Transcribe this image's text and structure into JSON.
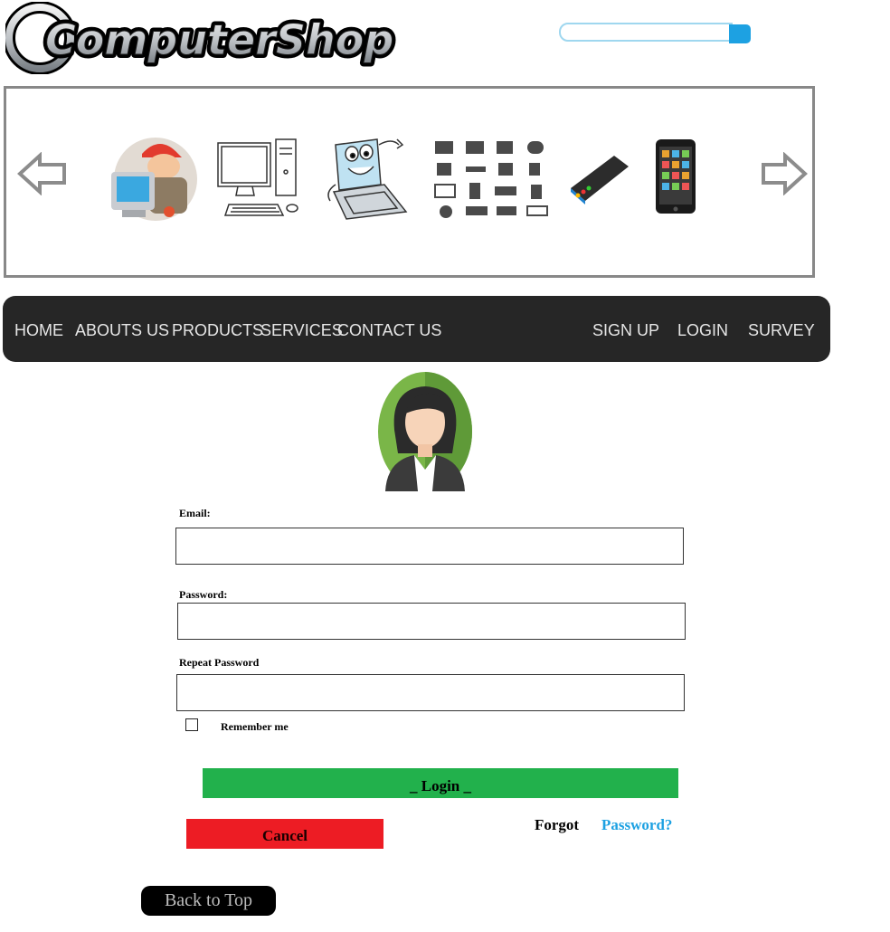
{
  "brand": {
    "logo_text": "ComputerShop",
    "accent_color": "#1da1e2"
  },
  "search": {
    "value": "",
    "placeholder": ""
  },
  "carousel": {
    "items": [
      "technician-icon",
      "desktop-pc-icon",
      "laptop-mascot-icon",
      "hardware-grid-icon",
      "smartphone-icon",
      "tablet-icon"
    ]
  },
  "nav": {
    "left": [
      {
        "label": "HOME"
      },
      {
        "label": "ABOUTS US"
      },
      {
        "label": "PRODUCTS"
      },
      {
        "label": "SERVICES"
      },
      {
        "label": "CONTACT US"
      }
    ],
    "right": [
      {
        "label": "SIGN UP"
      },
      {
        "label": "LOGIN"
      },
      {
        "label": "SURVEY"
      }
    ]
  },
  "form": {
    "email_label": "Email:",
    "email_value": "",
    "password_label": "Password:",
    "password_value": "",
    "repeat_label": "Repeat Password",
    "repeat_value": "",
    "remember_label": "Remember me",
    "login_label": "_ Login _",
    "cancel_label": "Cancel",
    "forgot_text": "Forgot",
    "forgot_link": "Password?"
  },
  "footer": {
    "back_to_top": "Back to Top"
  },
  "colors": {
    "nav_bg": "#262626",
    "login_green": "#22b14c",
    "cancel_red": "#ed1c24",
    "link_blue": "#1da1e2"
  }
}
